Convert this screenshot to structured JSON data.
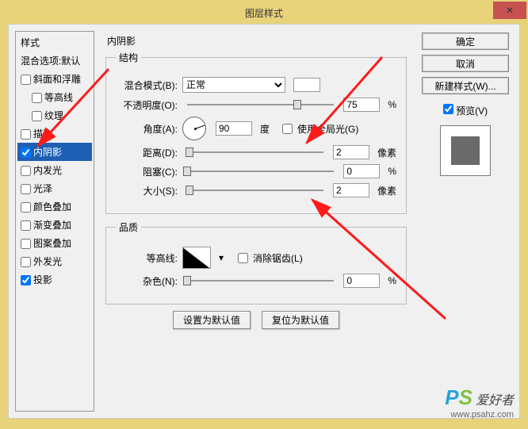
{
  "title": "图层样式",
  "close": "✕",
  "left": {
    "header": "样式",
    "blend": "混合选项:默认",
    "bevel": "斜面和浮雕",
    "contour": "等高线",
    "texture": "纹理",
    "stroke": "描边",
    "innerShadow": "内阴影",
    "innerGlow": "内发光",
    "satin": "光泽",
    "colorOverlay": "颜色叠加",
    "gradientOverlay": "渐变叠加",
    "patternOverlay": "图案叠加",
    "outerGlow": "外发光",
    "dropShadow": "投影"
  },
  "center": {
    "heading": "内阴影",
    "structure": "结构",
    "blendMode": "混合模式(B):",
    "blendModeValue": "正常",
    "opacity": "不透明度(O):",
    "opacityValue": "75",
    "percent": "%",
    "angle": "角度(A):",
    "angleValue": "90",
    "degree": "度",
    "globalLight": "使用全局光(G)",
    "distance": "距离(D):",
    "distanceValue": "2",
    "pixel": "像素",
    "choke": "阻塞(C):",
    "chokeValue": "0",
    "size": "大小(S):",
    "sizeValue": "2",
    "quality": "品质",
    "contourLabel": "等高线:",
    "antiAlias": "消除锯齿(L)",
    "noise": "杂色(N):",
    "noiseValue": "0",
    "setDefault": "设置为默认值",
    "resetDefault": "复位为默认值"
  },
  "right": {
    "ok": "确定",
    "cancel": "取消",
    "newStyle": "新建样式(W)...",
    "preview": "预览(V)"
  },
  "watermark": {
    "cn": "爱好者",
    "url": "www.psahz.com"
  }
}
